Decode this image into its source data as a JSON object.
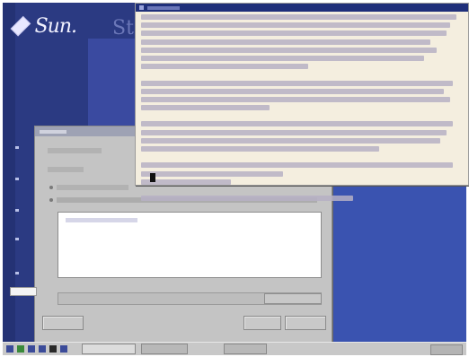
{
  "desktop": {
    "logo_text": "Sun.",
    "banner_fragment": "Sta"
  },
  "colors": {
    "desktop": "#2b3a82",
    "terminal_background": "#f4eedf",
    "dialog_background": "#c4c4c4",
    "taskbar": "#c8c8c8"
  },
  "icons": [
    "sun-logo-icon",
    "terminal-icon",
    "folder-icon",
    "globe-icon",
    "mail-icon"
  ]
}
